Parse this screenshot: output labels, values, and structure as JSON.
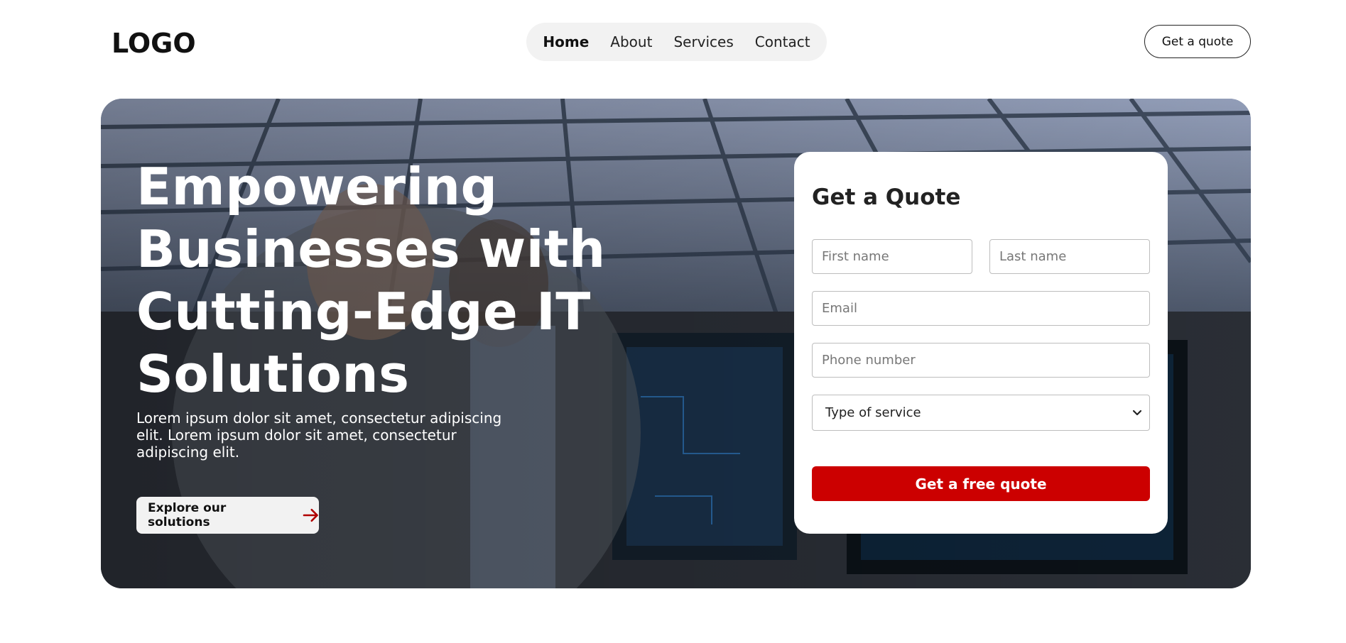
{
  "header": {
    "logo": "LOGO",
    "nav": [
      {
        "label": "Home",
        "active": true
      },
      {
        "label": "About",
        "active": false
      },
      {
        "label": "Services",
        "active": false
      },
      {
        "label": "Contact",
        "active": false
      }
    ],
    "quote_button": "Get a quote"
  },
  "hero": {
    "title": "Empowering Businesses with Cutting-Edge IT Solutions",
    "text": "Lorem ipsum dolor sit amet, consectetur adipiscing elit. Lorem ipsum dolor sit amet, consectetur adipiscing elit.",
    "cta_label": "Explore our solutions",
    "cta_icon": "arrow-right-icon"
  },
  "form": {
    "title": "Get a Quote",
    "first_name_placeholder": "First name",
    "last_name_placeholder": "Last name",
    "email_placeholder": "Email",
    "phone_placeholder": "Phone number",
    "service_selected": "Type of service",
    "submit_label": "Get a free quote"
  },
  "colors": {
    "accent": "#cc0000",
    "text": "#111111",
    "nav_bg": "#f2f2f2"
  }
}
